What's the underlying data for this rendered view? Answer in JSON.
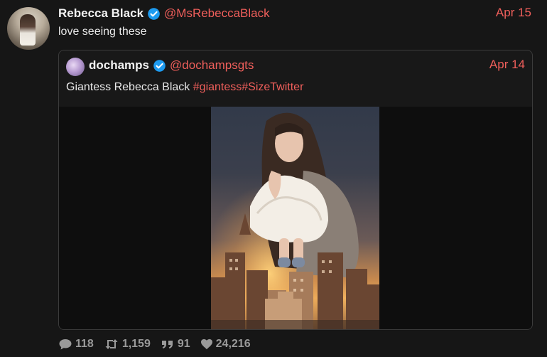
{
  "tweet": {
    "author_name": "Rebecca Black",
    "author_handle": "@MsRebeccaBlack",
    "date": "Apr 15",
    "text": "love seeing these"
  },
  "quoted_tweet": {
    "author_name": "dochamps",
    "author_handle": "@dochampsgts",
    "date": "Apr 14",
    "text_plain": "Giantess Rebecca Black",
    "hashtags": [
      "#giantess",
      "#SizeTwitter"
    ]
  },
  "metrics": {
    "replies": "118",
    "retweets": "1,159",
    "quotes": "91",
    "likes": "24,216"
  },
  "icons": {
    "verified": "verified-badge-icon",
    "reply": "reply-bubble-icon",
    "retweet": "retweet-icon",
    "quote": "quote-icon",
    "like": "heart-icon"
  },
  "colors": {
    "background": "#161616",
    "accent": "#f05f5b",
    "verified": "#1d9bf0",
    "text": "#e8e8e8",
    "muted": "#9a9a9a"
  }
}
